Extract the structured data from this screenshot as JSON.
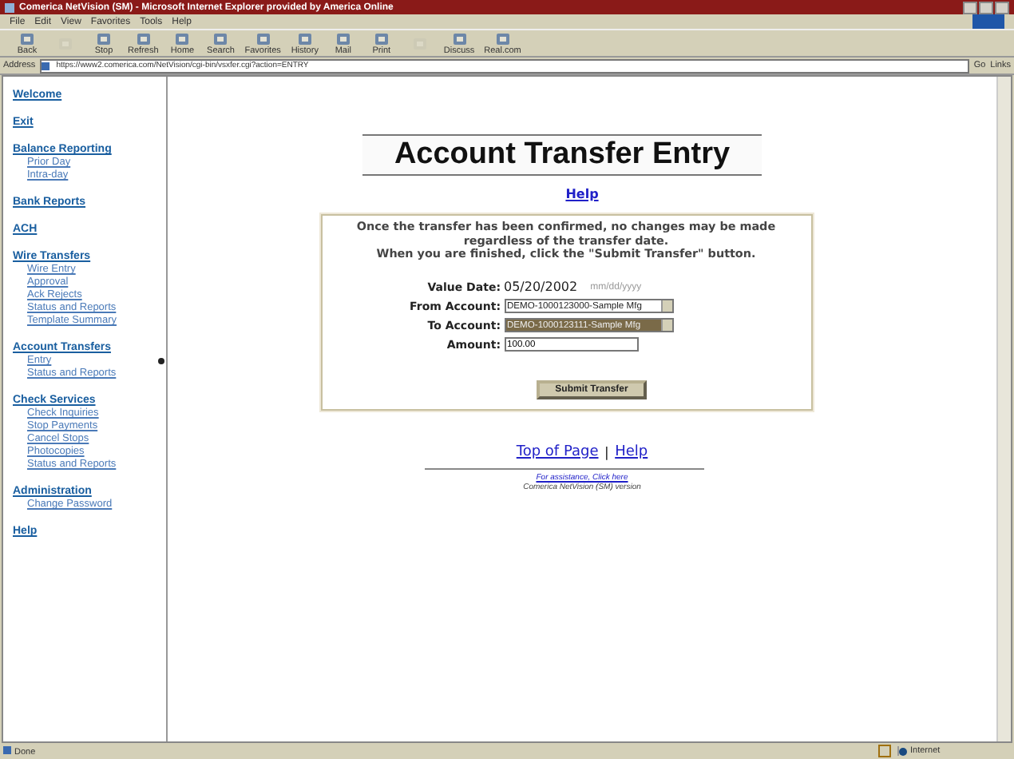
{
  "window": {
    "title": "Comerica NetVision (SM) - Microsoft Internet Explorer provided by America Online"
  },
  "menu": [
    "File",
    "Edit",
    "View",
    "Favorites",
    "Tools",
    "Help"
  ],
  "toolbar": [
    {
      "label": "Back",
      "disabled": false
    },
    {
      "disabled": true
    },
    {
      "label": "Stop",
      "disabled": false
    },
    {
      "label": "Refresh",
      "disabled": false
    },
    {
      "label": "Home",
      "disabled": false
    },
    {
      "label": "Search",
      "disabled": false
    },
    {
      "label": "Favorites",
      "disabled": false
    },
    {
      "label": "History",
      "disabled": false
    },
    {
      "label": "Mail",
      "disabled": false
    },
    {
      "label": "Print",
      "disabled": false
    },
    {
      "disabled": true
    },
    {
      "label": "Discuss",
      "disabled": false
    },
    {
      "label": "Real.com",
      "disabled": false
    }
  ],
  "address": {
    "label": "Address",
    "value": "https://www2.comerica.com/NetVision/cgi-bin/vsxfer.cgi?action=ENTRY",
    "go": "Go",
    "links": "Links"
  },
  "sidebar": [
    {
      "label": "Welcome"
    },
    {
      "label": "Exit"
    },
    {
      "label": "Balance Reporting",
      "children": [
        {
          "label": "Prior Day",
          "current": false
        },
        {
          "label": "Intra-day",
          "current": false
        }
      ]
    },
    {
      "label": "Bank Reports"
    },
    {
      "label": "ACH"
    },
    {
      "label": "Wire Transfers",
      "children": [
        {
          "label": "Wire Entry",
          "current": false
        },
        {
          "label": "Approval",
          "current": false
        },
        {
          "label": "Ack Rejects",
          "current": false
        },
        {
          "label": "Status and Reports",
          "current": false
        },
        {
          "label": "Template Summary",
          "current": false
        }
      ]
    },
    {
      "label": "Account Transfers",
      "children": [
        {
          "label": "Entry",
          "current": true
        },
        {
          "label": "Status and Reports",
          "current": false
        }
      ]
    },
    {
      "label": "Check Services",
      "children": [
        {
          "label": "Check Inquiries",
          "current": false
        },
        {
          "label": "Stop Payments",
          "current": false
        },
        {
          "label": "Cancel Stops",
          "current": false
        },
        {
          "label": "Photocopies",
          "current": false
        },
        {
          "label": "Status and Reports",
          "current": false
        }
      ]
    },
    {
      "label": "Administration",
      "children": [
        {
          "label": "Change Password",
          "current": false
        }
      ]
    },
    {
      "label": "Help"
    }
  ],
  "page": {
    "title": "Account Transfer Entry",
    "help": "Help",
    "notice": [
      "Once the transfer has been confirmed, no changes may be made regardless of the transfer date.",
      "When you are finished, click the \"Submit Transfer\" button."
    ],
    "value_date": {
      "label": "Value Date:",
      "value": "05/20/2002",
      "hint": "mm/dd/yyyy"
    },
    "accounts": [
      {
        "label": "From Account:",
        "value": "DEMO-1000123000-Sample Mfg",
        "highlighted": false
      },
      {
        "label": "To Account:",
        "value": "DEMO-1000123111-Sample Mfg",
        "highlighted": true
      }
    ],
    "amount": {
      "label": "Amount:",
      "value": "100.00"
    },
    "submit": "Submit Transfer",
    "footer_links": [
      "Top of Page",
      "Help"
    ],
    "separator": "|",
    "assistance": "For assistance, Click here",
    "version": "Comerica NetVision (SM) version"
  },
  "status_bar": {
    "text": "Done",
    "zone": "Internet"
  }
}
